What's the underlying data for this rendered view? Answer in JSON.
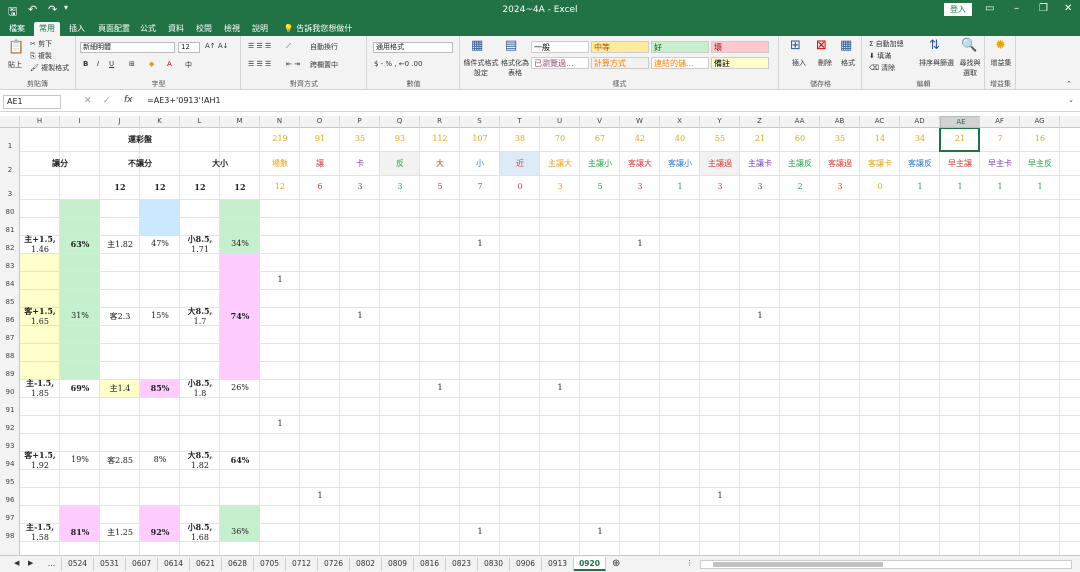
{
  "title": "2024~4A  -  Excel",
  "login": "登入",
  "ribbon_tabs": [
    "檔案",
    "常用",
    "插入",
    "頁面配置",
    "公式",
    "資料",
    "校閱",
    "檢視",
    "說明"
  ],
  "tell_me": "告訴我您想做什麼",
  "ribbon": {
    "paste": "貼上",
    "cut": "剪下",
    "copy": "複製",
    "format_painter": "複製格式",
    "clipboard_label": "剪貼簿",
    "font_name": "新細明體",
    "font_size": "12",
    "font_label": "字型",
    "wrap": "自動換行",
    "merge": "跨欄置中",
    "align_label": "對齊方式",
    "number_format": "通用格式",
    "number_label": "數值",
    "cond_format": "條件式格式設定",
    "format_table": "格式化為表格",
    "styles": [
      "一般",
      "中等",
      "好",
      "壞",
      "已瀏覽過...",
      "計算方式",
      "連結的儲...",
      "備註"
    ],
    "style_colors": [
      "#ffffff",
      "#ffeb9c",
      "#c6efce",
      "#ffc7ce",
      "#ffffff",
      "#f2f2f2",
      "#ffffff",
      "#ffffcc"
    ],
    "style_text": [
      "#000000",
      "#9c5700",
      "#006100",
      "#9c0006",
      "#954f72",
      "#fa7d00",
      "#fa7d00",
      "#000000"
    ],
    "style_label": "樣式",
    "insert": "插入",
    "delete": "刪除",
    "format": "格式",
    "cells_label": "儲存格",
    "autosum": "自動加總",
    "fill": "填滿",
    "clear": "清除",
    "sort": "排序與篩選",
    "find": "尋找與選取",
    "edit_label": "編輯",
    "addins": "增益集",
    "addins_label": "增益集"
  },
  "name_box": "AE1",
  "formula": "=AE3+'0913'!AH1",
  "columns": [
    "H",
    "I",
    "J",
    "K",
    "L",
    "M",
    "N",
    "O",
    "P",
    "Q",
    "R",
    "S",
    "T",
    "U",
    "V",
    "W",
    "X",
    "Y",
    "Z",
    "AA",
    "AB",
    "AC",
    "AD",
    "AE",
    "AF",
    "AG"
  ],
  "rows": [
    "1",
    "2",
    "3",
    "80",
    "81",
    "82",
    "83",
    "84",
    "85",
    "86",
    "87",
    "88",
    "89",
    "90",
    "91",
    "92",
    "93",
    "94",
    "95",
    "96",
    "97",
    "98"
  ],
  "header": {
    "title": "運彩盤",
    "g1": "讓分",
    "g2": "不讓分",
    "g3": "大小",
    "r3": [
      "12",
      "12",
      "12",
      "12"
    ]
  },
  "stats_row1": [
    "219",
    "91",
    "35",
    "93",
    "112",
    "107",
    "38",
    "70",
    "67",
    "42",
    "40",
    "55",
    "21",
    "60",
    "35",
    "14",
    "34",
    "21",
    "7",
    "16"
  ],
  "stats_row2": [
    "場數",
    "讓",
    "卡",
    "反",
    "大",
    "小",
    "近",
    "主讓大",
    "主讓小",
    "客讓大",
    "客讓小",
    "主讓過",
    "主讓卡",
    "主讓反",
    "客讓過",
    "客讓卡",
    "客讓反",
    "早主讓",
    "早主卡",
    "早主反"
  ],
  "stats_row2_colors": [
    "#e8a317",
    "#d63b3b",
    "#7b3fb0",
    "#2aa14a",
    "#d63b3b",
    "#2d78c8",
    "#d63b3b",
    "#e8a317",
    "#2aa14a",
    "#d63b3b",
    "#2d78c8",
    "#d63b3b",
    "#7b3fb0",
    "#2aa14a",
    "#d63b3b",
    "#e8a317",
    "#2d78c8",
    "#d63b3b",
    "#7b3fb0",
    "#2aa14a"
  ],
  "stats_row3": [
    "12",
    "6",
    "3",
    "3",
    "5",
    "7",
    "0",
    "3",
    "5",
    "3",
    "1",
    "3",
    "3",
    "2",
    "3",
    "0",
    "1",
    "1",
    "1",
    "1"
  ],
  "stats_row3_colors": [
    "#e8a317",
    "#d63b3b",
    "#7b3fb0",
    "#2aa14a",
    "#d63b3b",
    "#2d78c8",
    "#d63b3b",
    "#e8a317",
    "#2aa14a",
    "#d63b3b",
    "#2d78c8",
    "#d63b3b",
    "#7b3fb0",
    "#2aa14a",
    "#d63b3b",
    "#e8a317",
    "#2d78c8",
    "#2aa14a",
    "#2aa14a",
    "#2aa14a"
  ],
  "blocks": [
    {
      "h": "主+1.5,",
      "h2": "1.46",
      "i": "63%",
      "j": "主1.82",
      "k": "47%",
      "l": "小8.5,",
      "l2": "1.71",
      "m": "34%",
      "ifill": "#c6efce",
      "mfill": "#c6efce",
      "jfill": "",
      "kfill": "",
      "ib": true,
      "mb": false
    },
    {
      "h": "客+1.5,",
      "h2": "1.65",
      "i": "31%",
      "j": "客2.3",
      "k": "15%",
      "l": "大8.5,",
      "l2": "1.7",
      "m": "74%",
      "hfill": "#ffffcc",
      "ifill": "#c6efce",
      "mfill": "#ffccff",
      "ib": false,
      "mb": true
    },
    {
      "h": "主-1.5,",
      "h2": "1.85",
      "i": "69%",
      "j": "主1.4",
      "k": "85%",
      "l": "小8.5,",
      "l2": "1.8",
      "m": "26%",
      "jfill": "#ffffcc",
      "kfill": "#ffccff",
      "ib": true,
      "kb": true
    },
    {
      "h": "客+1.5,",
      "h2": "1.92",
      "i": "19%",
      "j": "客2.85",
      "k": "8%",
      "l": "大8.5,",
      "l2": "1.82",
      "m": "64%",
      "mb": true
    },
    {
      "h": "主-1.5,",
      "h2": "1.58",
      "i": "81%",
      "j": "主1.25",
      "k": "92%",
      "l": "小8.5,",
      "l2": "1.68",
      "m": "36%",
      "ifill": "#ffccff",
      "kfill": "#ffccff",
      "mfill": "#c6efce",
      "ib": true,
      "kb": true
    }
  ],
  "marks": [
    {
      "col": "S",
      "row": "82",
      "v": "1"
    },
    {
      "col": "W",
      "row": "82",
      "v": "1"
    },
    {
      "col": "N",
      "row": "84",
      "v": "1"
    },
    {
      "col": "P",
      "row": "86",
      "v": "1"
    },
    {
      "col": "Z",
      "row": "86",
      "v": "1"
    },
    {
      "col": "R",
      "row": "90",
      "v": "1"
    },
    {
      "col": "U",
      "row": "90",
      "v": "1"
    },
    {
      "col": "N",
      "row": "92",
      "v": "1"
    },
    {
      "col": "O",
      "row": "96",
      "v": "1"
    },
    {
      "col": "Y",
      "row": "96",
      "v": "1"
    },
    {
      "col": "S",
      "row": "98",
      "v": "1"
    },
    {
      "col": "V",
      "row": "98",
      "v": "1"
    }
  ],
  "sheets": [
    "...",
    "0524",
    "0531",
    "0607",
    "0614",
    "0621",
    "0628",
    "0705",
    "0712",
    "0726",
    "0802",
    "0809",
    "0816",
    "0823",
    "0830",
    "0906",
    "0913",
    "0920"
  ],
  "active_sheet": "0920"
}
